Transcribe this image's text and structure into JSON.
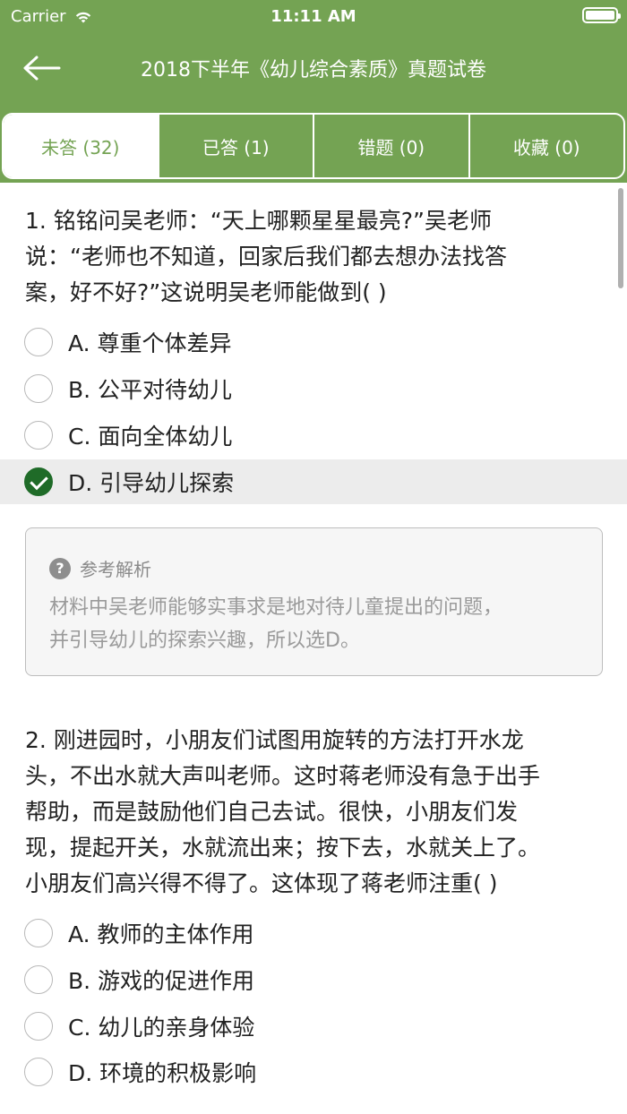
{
  "status_bar": {
    "carrier": "Carrier",
    "time": "11:11 AM"
  },
  "nav": {
    "title": "2018下半年《幼儿综合素质》真题试卷"
  },
  "tabs": [
    {
      "label": "未答 (32)",
      "active": true
    },
    {
      "label": "已答 (1)"
    },
    {
      "label": "错题 (0)"
    },
    {
      "label": "收藏 (0)"
    }
  ],
  "questions": [
    {
      "lines": [
        "1. 铭铭问吴老师：“天上哪颗星星最亮?”吴老师",
        "说：“老师也不知道，回家后我们都去想办法找答",
        "案，好不好?”这说明吴老师能做到(    )"
      ],
      "options": [
        {
          "label": "A. 尊重个体差异"
        },
        {
          "label": "B. 公平对待幼儿"
        },
        {
          "label": "C. 面向全体幼儿"
        },
        {
          "label": "D. 引导幼儿探索",
          "selected": true
        }
      ],
      "analysis": {
        "title": "参考解析",
        "lines": [
          "材料中吴老师能够实事求是地对待儿童提出的问题，",
          "并引导幼儿的探索兴趣，所以选D。"
        ]
      }
    },
    {
      "lines": [
        "2. 刚进园时，小朋友们试图用旋转的方法打开水龙",
        "头，不出水就大声叫老师。这时蒋老师没有急于出手",
        "帮助，而是鼓励他们自己去试。很快，小朋友们发",
        "现，提起开关，水就流出来；按下去，水就关上了。",
        "小朋友们高兴得不得了。这体现了蒋老师注重(    )"
      ],
      "options": [
        {
          "label": "A. 教师的主体作用"
        },
        {
          "label": "B. 游戏的促进作用"
        },
        {
          "label": "C. 幼儿的亲身体验"
        },
        {
          "label": "D. 环境的积极影响"
        }
      ]
    }
  ],
  "colors": {
    "theme": "#74a353",
    "check": "#1f6b28"
  }
}
